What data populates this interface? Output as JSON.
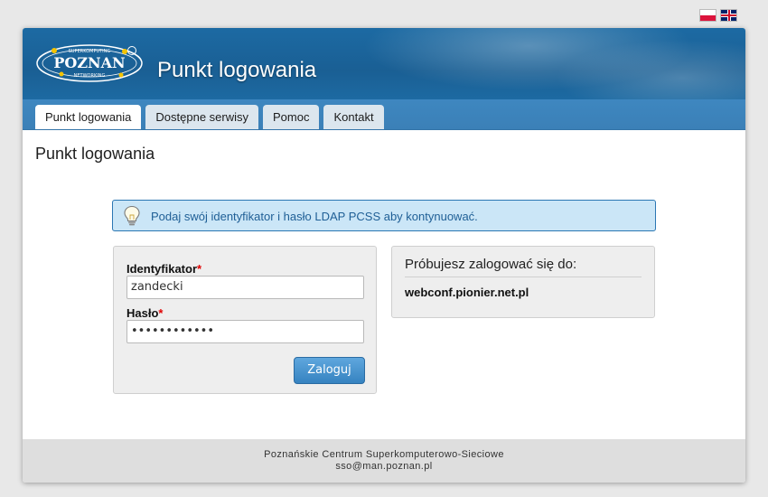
{
  "lang": {
    "pl": "Polski",
    "en": "English"
  },
  "header": {
    "logo": {
      "top": "SUPERKOMPUTING",
      "main": "POZNAN",
      "bottom": "NETWORKING"
    },
    "title": "Punkt logowania"
  },
  "tabs": [
    {
      "label": "Punkt logowania",
      "active": true
    },
    {
      "label": "Dostępne serwisy",
      "active": false
    },
    {
      "label": "Pomoc",
      "active": false
    },
    {
      "label": "Kontakt",
      "active": false
    }
  ],
  "page": {
    "title": "Punkt logowania"
  },
  "info": {
    "icon": "lightbulb-icon",
    "text": "Podaj swój identyfikator i hasło LDAP PCSS aby kontynuować."
  },
  "login": {
    "username": {
      "label": "Identyfikator",
      "required": "*",
      "value": "zandecki"
    },
    "password": {
      "label": "Hasło",
      "required": "*",
      "value": "••••••••••••"
    },
    "submit_label": "Zaloguj"
  },
  "target": {
    "heading": "Próbujesz zalogować się do:",
    "host": "webconf.pionier.net.pl"
  },
  "footer": {
    "org": "Poznańskie Centrum Superkomputerowo-Sieciowe",
    "email": "sso@man.poznan.pl"
  },
  "colors": {
    "banner": "#1a5f94",
    "tabbar": "#3e87c0",
    "info_bg": "#cbe6f7",
    "button": "#3683c0"
  }
}
